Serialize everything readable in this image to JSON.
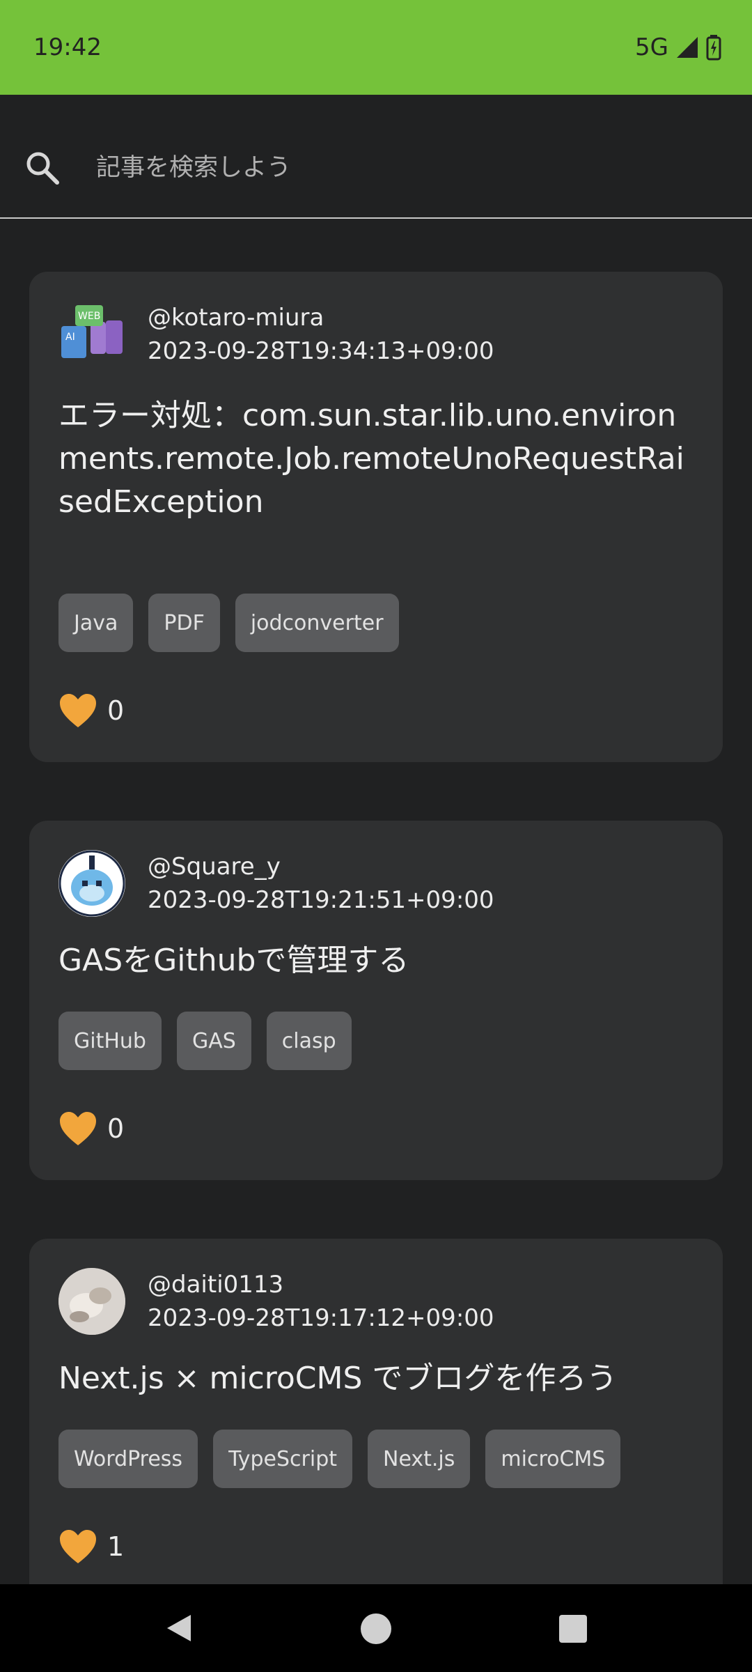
{
  "status": {
    "time": "19:42",
    "network": "5G"
  },
  "search": {
    "placeholder": "記事を検索しよう",
    "value": ""
  },
  "posts": [
    {
      "username": "@kotaro-miura",
      "date": "2023-09-28T19:34:13+09:00",
      "title": "エラー対処：com.sun.star.lib.uno.environments.remote.Job.remoteUnoRequestRaisedException",
      "tags": [
        "Java",
        "PDF",
        "jodconverter"
      ],
      "likes": "0"
    },
    {
      "username": "@Square_y",
      "date": "2023-09-28T19:21:51+09:00",
      "title": "GASをGithubで管理する",
      "tags": [
        "GitHub",
        "GAS",
        "clasp"
      ],
      "likes": "0"
    },
    {
      "username": "@daiti0113",
      "date": "2023-09-28T19:17:12+09:00",
      "title": "Next.js × microCMS でブログを作ろう",
      "tags": [
        "WordPress",
        "TypeScript",
        "Next.js",
        "microCMS"
      ],
      "likes": "1"
    }
  ],
  "colors": {
    "accent": "#75c23a",
    "heart": "#f2a63c",
    "card": "#2f3031",
    "background": "#202122"
  }
}
